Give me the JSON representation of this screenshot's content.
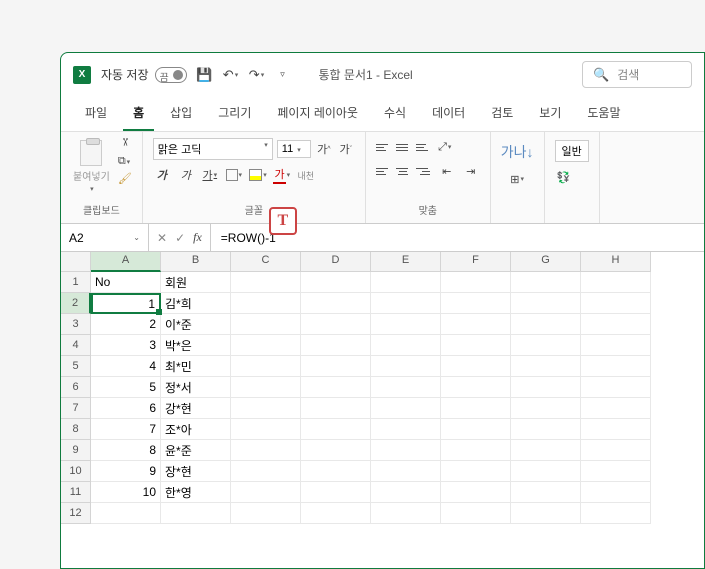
{
  "titlebar": {
    "auto_save": "자동 저장",
    "toggle_state": "끔",
    "title": "통합 문서1 - Excel",
    "search_placeholder": "검색"
  },
  "tabs": [
    "파일",
    "홈",
    "삽입",
    "그리기",
    "페이지 레이아웃",
    "수식",
    "데이터",
    "검토",
    "보기",
    "도움말"
  ],
  "active_tab": 1,
  "ribbon": {
    "clipboard": {
      "paste": "붙여넣기",
      "label": "클립보드"
    },
    "font": {
      "name": "맑은 고딕",
      "size": "11",
      "incr": "가^",
      "decr": "가ˇ",
      "label": "글꼴",
      "bold": "가",
      "italic": "가",
      "underline": "가",
      "phonetic": "내천"
    },
    "align": {
      "label": "맞춤"
    },
    "sort": {
      "label": "가나"
    },
    "number": {
      "label": "일반"
    }
  },
  "name_box": "A2",
  "formula": "=ROW()-1",
  "columns": [
    "",
    "A",
    "B",
    "C",
    "D",
    "E",
    "F",
    "G",
    "H"
  ],
  "rows": [
    {
      "n": 1,
      "a": "No",
      "b": "회원"
    },
    {
      "n": 2,
      "a": "1",
      "b": "김*희"
    },
    {
      "n": 3,
      "a": "2",
      "b": "이*준"
    },
    {
      "n": 4,
      "a": "3",
      "b": "박*은"
    },
    {
      "n": 5,
      "a": "4",
      "b": "최*민"
    },
    {
      "n": 6,
      "a": "5",
      "b": "정*서"
    },
    {
      "n": 7,
      "a": "6",
      "b": "강*현"
    },
    {
      "n": 8,
      "a": "7",
      "b": "조*아"
    },
    {
      "n": 9,
      "a": "8",
      "b": "윤*준"
    },
    {
      "n": 10,
      "a": "9",
      "b": "장*현"
    },
    {
      "n": 11,
      "a": "10",
      "b": "한*영"
    },
    {
      "n": 12,
      "a": "",
      "b": ""
    }
  ],
  "selected_cell": {
    "row": 2,
    "col": "A"
  }
}
